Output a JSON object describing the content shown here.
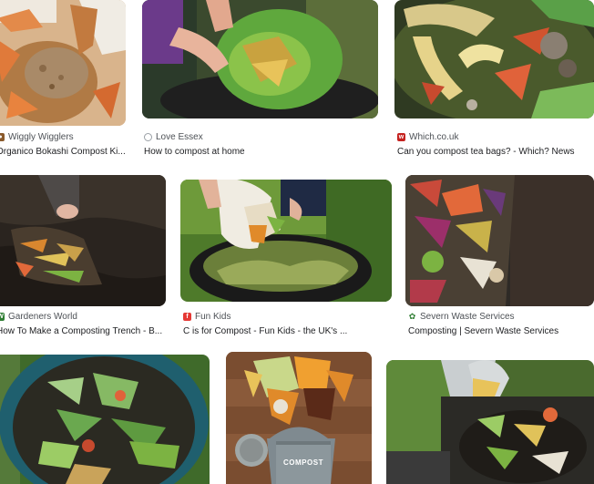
{
  "results": [
    {
      "source": "Wiggly Wigglers",
      "title": "Organico Bokashi Compost Ki...",
      "favicon": "leaf-favicon-icon",
      "favicon_color": "#8a5a2b"
    },
    {
      "source": "Love Essex",
      "title": "How to compost at home",
      "favicon": "globe-favicon-icon",
      "favicon_color": "#5f6368"
    },
    {
      "source": "Which.co.uk",
      "title": "Can you compost tea bags? - Which? News",
      "favicon": "which-favicon-icon",
      "favicon_color": "#c5221f"
    },
    {
      "source": "Gardeners World",
      "title": "How To Make a Composting Trench - B...",
      "favicon": "gw-favicon-icon",
      "favicon_color": "#2e7d32"
    },
    {
      "source": "Fun Kids",
      "title": "C is for Compost - Fun Kids - the UK's ...",
      "favicon": "funkids-favicon-icon",
      "favicon_color": "#e53935"
    },
    {
      "source": "Severn Waste Services",
      "title": "Composting | Severn Waste Services",
      "favicon": "severn-favicon-icon",
      "favicon_color": "#2e7d32"
    },
    {
      "source": "",
      "title": "",
      "favicon": "",
      "favicon_color": ""
    },
    {
      "source": "",
      "title": "",
      "favicon": "",
      "favicon_color": ""
    },
    {
      "source": "",
      "title": "",
      "favicon": "",
      "favicon_color": ""
    }
  ],
  "caddy_label": "COMPOST"
}
